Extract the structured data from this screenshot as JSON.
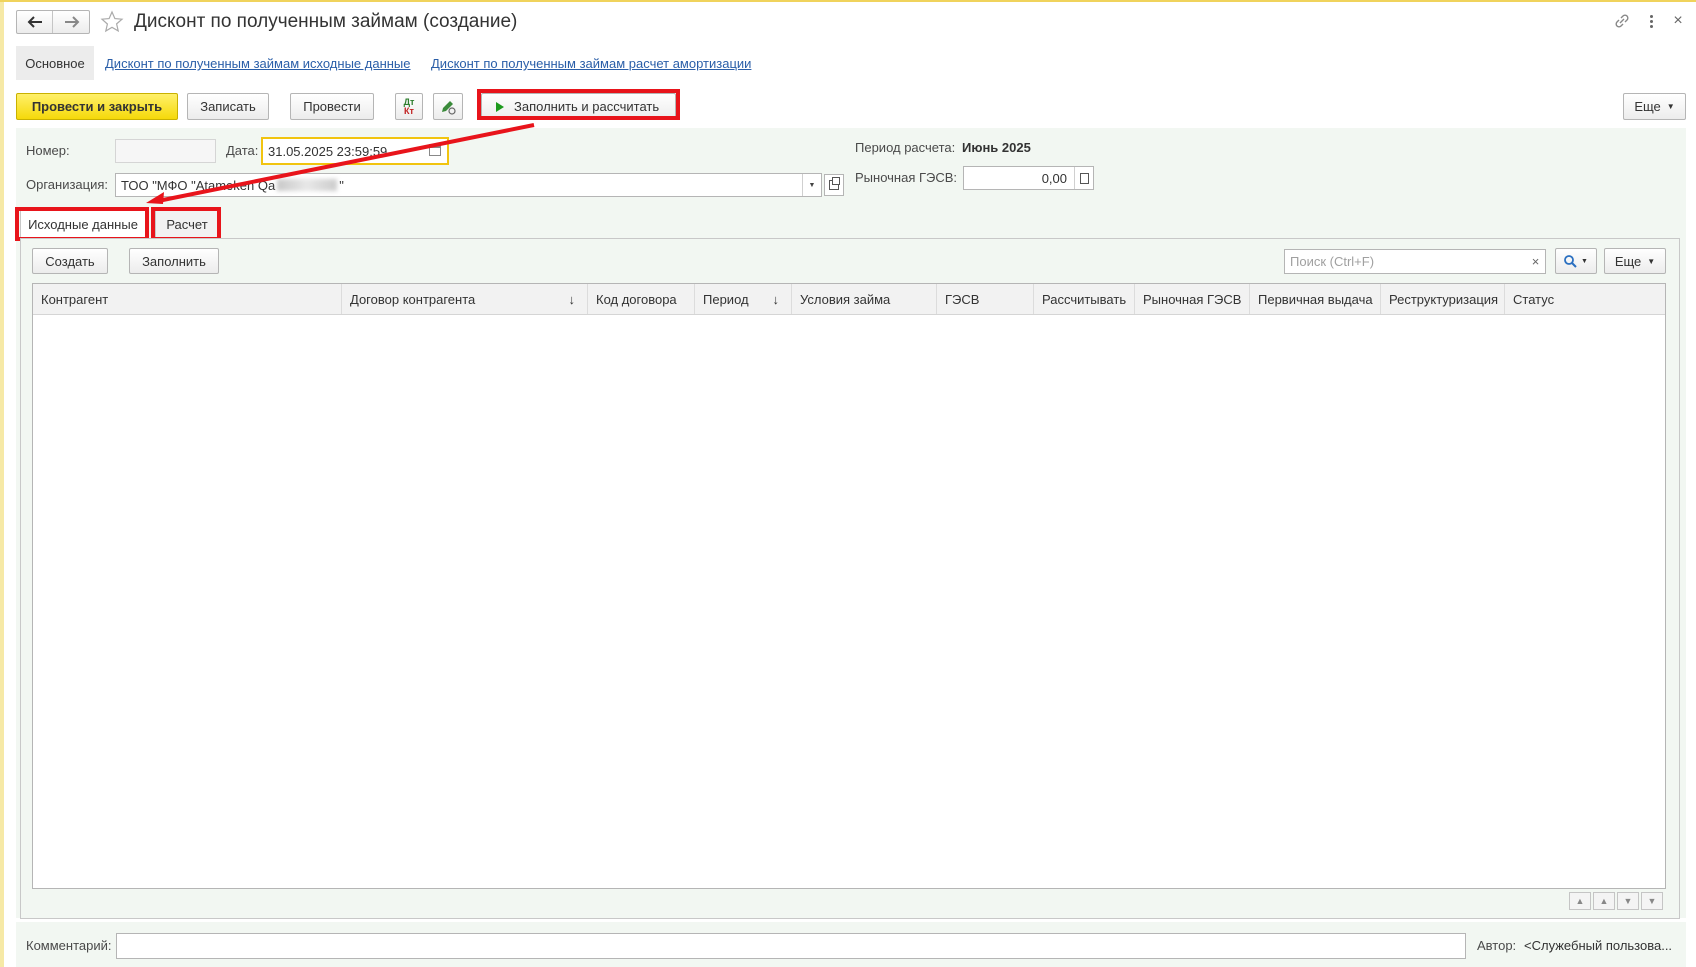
{
  "window": {
    "title": "Дисконт по полученным займам (создание)"
  },
  "nav_tabs": {
    "main": "Основное",
    "link1": "Дисконт по полученным займам исходные данные",
    "link2": "Дисконт по полученным займам расчет амортизации"
  },
  "toolbar": {
    "post_close": "Провести и закрыть",
    "save": "Записать",
    "post": "Провести",
    "fill_calc": "Заполнить и рассчитать",
    "more": "Еще"
  },
  "form": {
    "number_label": "Номер:",
    "number_value": "",
    "date_label": "Дата:",
    "date_value": "31.05.2025 23:59:59",
    "org_label": "Организация:",
    "org_value": "ТОО \"МФО \"Atameken Qa",
    "org_value_end": "\"",
    "period_label": "Период расчета:",
    "period_value": "Июнь 2025",
    "market_label": "Рыночная ГЭСВ:",
    "market_value": "0,00"
  },
  "tabs": {
    "source": "Исходные данные",
    "calc": "Расчет"
  },
  "table_toolbar": {
    "create": "Создать",
    "fill": "Заполнить",
    "search_placeholder": "Поиск (Ctrl+F)",
    "more": "Еще"
  },
  "table": {
    "columns": [
      "Контрагент",
      "Договор контрагента",
      "Код договора",
      "Период",
      "Условия займа",
      "ГЭСВ",
      "Рассчитывать",
      "Рыночная ГЭСВ",
      "Первичная выдача",
      "Реструктуризация",
      "Статус"
    ],
    "rows": []
  },
  "footer": {
    "comment_label": "Комментарий:",
    "comment_value": "",
    "author_label": "Автор:",
    "author_value": "<Служебный пользова..."
  },
  "colors": {
    "accent_yellow": "#f5d90a",
    "annotation_red": "#e8141b",
    "link_blue": "#2a5ea8",
    "panel_green": "#f2f7f2"
  }
}
